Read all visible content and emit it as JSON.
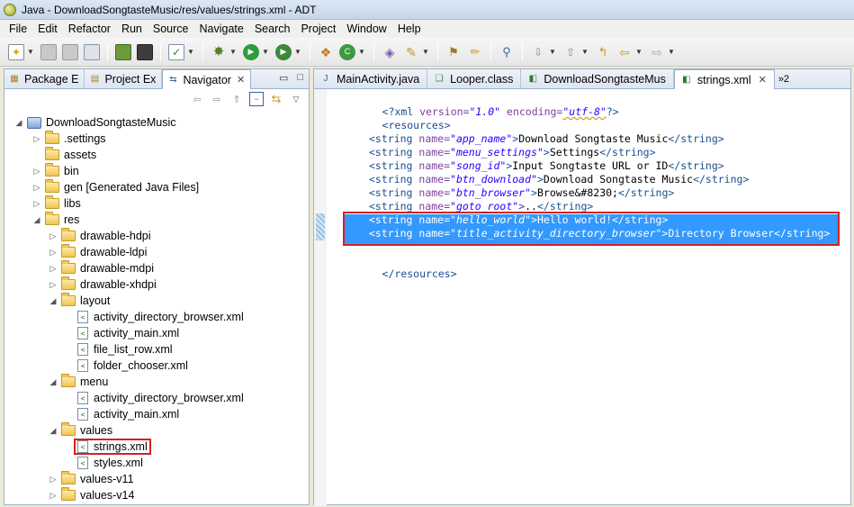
{
  "window": {
    "title": "Java - DownloadSongtasteMusic/res/values/strings.xml - ADT"
  },
  "menubar": {
    "items": [
      "File",
      "Edit",
      "Refactor",
      "Run",
      "Source",
      "Navigate",
      "Search",
      "Project",
      "Window",
      "Help"
    ]
  },
  "left_panel": {
    "tabs": [
      {
        "label": "Package E",
        "icon": "package-icon"
      },
      {
        "label": "Project Ex",
        "icon": "project-explorer-icon"
      },
      {
        "label": "Navigator",
        "icon": "navigator-icon",
        "active": true,
        "close": "✕"
      }
    ],
    "minimize": "▭",
    "maximize": "□"
  },
  "tree": {
    "project": "DownloadSongtasteMusic",
    "items": [
      {
        "label": ".settings",
        "type": "folder",
        "level": 1,
        "twisty": "▷"
      },
      {
        "label": "assets",
        "type": "folder",
        "level": 1,
        "twisty": ""
      },
      {
        "label": "bin",
        "type": "folder",
        "level": 1,
        "twisty": "▷"
      },
      {
        "label": "gen [Generated Java Files]",
        "type": "folder",
        "level": 1,
        "twisty": "▷"
      },
      {
        "label": "libs",
        "type": "folder",
        "level": 1,
        "twisty": "▷"
      },
      {
        "label": "res",
        "type": "folder",
        "level": 1,
        "twisty": "◢"
      },
      {
        "label": "drawable-hdpi",
        "type": "folder",
        "level": 2,
        "twisty": "▷"
      },
      {
        "label": "drawable-ldpi",
        "type": "folder",
        "level": 2,
        "twisty": "▷"
      },
      {
        "label": "drawable-mdpi",
        "type": "folder",
        "level": 2,
        "twisty": "▷"
      },
      {
        "label": "drawable-xhdpi",
        "type": "folder",
        "level": 2,
        "twisty": "▷"
      },
      {
        "label": "layout",
        "type": "folder",
        "level": 2,
        "twisty": "◢"
      },
      {
        "label": "activity_directory_browser.xml",
        "type": "file",
        "level": 3
      },
      {
        "label": "activity_main.xml",
        "type": "file",
        "level": 3
      },
      {
        "label": "file_list_row.xml",
        "type": "file",
        "level": 3
      },
      {
        "label": "folder_chooser.xml",
        "type": "file",
        "level": 3
      },
      {
        "label": "menu",
        "type": "folder",
        "level": 2,
        "twisty": "◢"
      },
      {
        "label": "activity_directory_browser.xml",
        "type": "file",
        "level": 3
      },
      {
        "label": "activity_main.xml",
        "type": "file",
        "level": 3
      },
      {
        "label": "values",
        "type": "folder",
        "level": 2,
        "twisty": "◢"
      },
      {
        "label": "strings.xml",
        "type": "file",
        "level": 3,
        "selected": true
      },
      {
        "label": "styles.xml",
        "type": "file",
        "level": 3
      },
      {
        "label": "values-v11",
        "type": "folder",
        "level": 2,
        "twisty": "▷"
      },
      {
        "label": "values-v14",
        "type": "folder",
        "level": 2,
        "twisty": "▷"
      }
    ]
  },
  "editor": {
    "tabs": [
      {
        "label": "MainActivity.java",
        "icon": "java-file-icon"
      },
      {
        "label": "Looper.class",
        "icon": "class-file-icon"
      },
      {
        "label": "DownloadSongtasteMus",
        "icon": "xml-file-icon"
      },
      {
        "label": "strings.xml",
        "icon": "xml-file-icon",
        "active": true,
        "close": "✕"
      }
    ],
    "more_tabs": "»2",
    "lines": {
      "decl": {
        "open": "<?xml ",
        "a1": "version=",
        "v1": "\"1.0\"",
        "a2": " encoding=",
        "v2": "\"utf-8\"",
        "close": "?>"
      },
      "resources_open": "<resources>",
      "resources_close": "</resources>",
      "strings": [
        {
          "name": "\"app_name\"",
          "value": "Download Songtaste Music"
        },
        {
          "name": "\"menu_settings\"",
          "value": "Settings"
        },
        {
          "name": "\"song_id\"",
          "value": "Input Songtaste URL or ID"
        },
        {
          "name": "\"btn_download\"",
          "value": "Download Songtaste Music"
        },
        {
          "name": "\"btn_browser\"",
          "value": "Browse&#8230;"
        },
        {
          "name": "\"goto_root\"",
          "value": ".."
        },
        {
          "name": "\"hello_world\"",
          "value": "Hello world!"
        },
        {
          "name": "\"title_activity_directory_browser\"",
          "value": "Directory Browser"
        }
      ],
      "tag_open": "<string ",
      "attr_name": "name=",
      "tag_gt": ">",
      "tag_close": "</string>"
    }
  },
  "colors": {
    "selection": "#3399ff",
    "highlight_box": "#d32222",
    "tag": "#1a4f8f",
    "attr": "#7f3f9f",
    "value": "#2a00ff"
  }
}
